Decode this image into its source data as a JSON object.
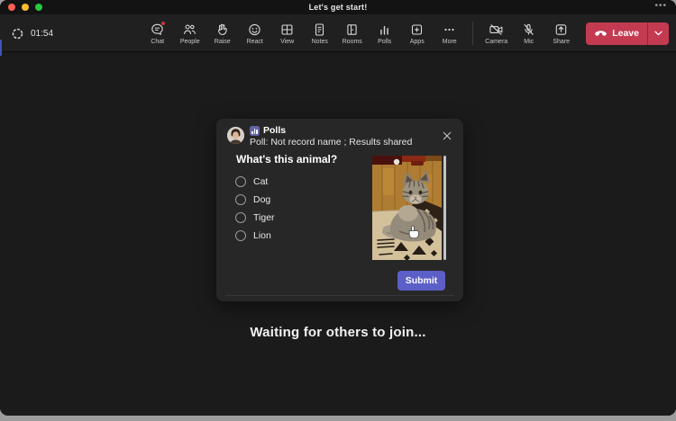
{
  "window": {
    "title": "Let's get start!",
    "overflow_menu": "•••"
  },
  "meeting": {
    "timer": "01:54"
  },
  "toolbar": {
    "items": [
      {
        "label": "Chat",
        "icon": "chat-icon",
        "has_badge": true
      },
      {
        "label": "People",
        "icon": "people-icon",
        "has_badge": false
      },
      {
        "label": "Raise",
        "icon": "raise-hand-icon",
        "has_badge": false
      },
      {
        "label": "React",
        "icon": "react-smiley-icon",
        "has_badge": false
      },
      {
        "label": "View",
        "icon": "view-grid-icon",
        "has_badge": false
      },
      {
        "label": "Notes",
        "icon": "notes-icon",
        "has_badge": false
      },
      {
        "label": "Rooms",
        "icon": "rooms-door-icon",
        "has_badge": false
      },
      {
        "label": "Polls",
        "icon": "polls-bars-icon",
        "has_badge": false
      },
      {
        "label": "Apps",
        "icon": "apps-plus-icon",
        "has_badge": false
      },
      {
        "label": "More",
        "icon": "more-dots-icon",
        "has_badge": false
      }
    ],
    "devices": [
      {
        "label": "Camera",
        "icon": "camera-off-icon",
        "muted": true
      },
      {
        "label": "Mic",
        "icon": "mic-off-icon",
        "muted": true
      },
      {
        "label": "Share",
        "icon": "share-screen-icon",
        "muted": false
      }
    ],
    "leave_label": "Leave"
  },
  "poll_popup": {
    "app_title": "Polls",
    "subtitle": "Poll: Not record name ; Results shared",
    "question": "What's this animal?",
    "options": [
      {
        "label": "Cat",
        "selected": false
      },
      {
        "label": "Dog",
        "selected": false
      },
      {
        "label": "Tiger",
        "selected": false
      },
      {
        "label": "Lion",
        "selected": false
      }
    ],
    "submit_label": "Submit",
    "image_subject": "tabby cat lying on patterned rug over wooden floor"
  },
  "stage": {
    "waiting_text": "Waiting for others to join..."
  },
  "colors": {
    "accent_purple": "#5b5fc7",
    "polls_app_purple": "#6264a7",
    "leave_red": "#c43a50",
    "badge_red": "#d13438",
    "toolbar_bg": "#202020",
    "stage_bg": "#1b1b1b",
    "popup_bg": "#272727",
    "traffic_red": "#ff5f57",
    "traffic_yellow": "#febc2e",
    "traffic_green": "#28c840"
  }
}
